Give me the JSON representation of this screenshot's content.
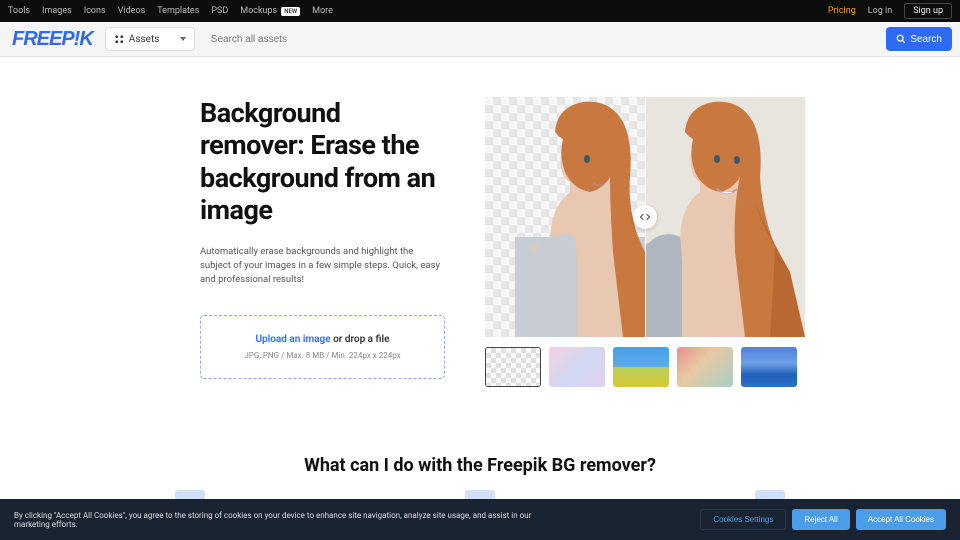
{
  "topNav": [
    "Tools",
    "Images",
    "Icons",
    "Videos",
    "Templates",
    "PSD",
    "Mockups",
    "More"
  ],
  "newBadge": "NEW",
  "topRight": {
    "pricing": "Pricing",
    "login": "Log in",
    "signup": "Sign up"
  },
  "logo": "FREEP!K",
  "assetsDropdown": "Assets",
  "searchPlaceholder": "Search all assets",
  "searchBtn": "Search",
  "hero": {
    "title": "Background remover: Erase the background from an image",
    "subtitle": "Automatically erase backgrounds and highlight the subject of your images in a few simple steps. Quick, easy and professional results!",
    "uploadLink": "Upload an image",
    "uploadRest": " or drop a file",
    "uploadSub": "JPG, PNG / Max. 8 MB / Min. 224px x 224px"
  },
  "sectionTitle": "What can I do with the Freepik BG remover?",
  "cookie": {
    "text": "By clicking \"Accept All Cookies\", you agree to the storing of cookies on your device to enhance site navigation, analyze site usage, and assist in our marketing efforts.",
    "settings": "Cookies Settings",
    "reject": "Reject All",
    "accept": "Accept All Cookies"
  }
}
